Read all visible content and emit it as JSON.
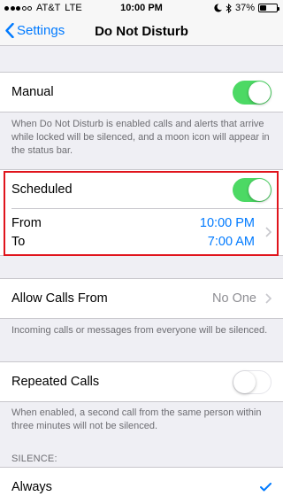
{
  "status_bar": {
    "carrier": "AT&T",
    "network": "LTE",
    "time": "10:00 PM",
    "battery": "37%",
    "battery_level": 0.37
  },
  "nav": {
    "back_label": "Settings",
    "title": "Do Not Disturb"
  },
  "manual": {
    "label": "Manual",
    "enabled": true,
    "footer": "When Do Not Disturb is enabled calls and alerts that arrive while locked will be silenced, and a moon icon will appear in the status bar."
  },
  "scheduled": {
    "label": "Scheduled",
    "enabled": true,
    "from_label": "From",
    "from_value": "10:00 PM",
    "to_label": "To",
    "to_value": "7:00 AM"
  },
  "allow_calls": {
    "label": "Allow Calls From",
    "value": "No One",
    "footer": "Incoming calls or messages from everyone will be silenced."
  },
  "repeated_calls": {
    "label": "Repeated Calls",
    "enabled": false,
    "footer": "When enabled, a second call from the same person within three minutes will not be silenced."
  },
  "silence": {
    "header": "SILENCE:",
    "option_always": "Always",
    "selected": "Always"
  },
  "colors": {
    "accent": "#007aff",
    "toggle_on": "#4cd964",
    "highlight": "#e0141c"
  }
}
